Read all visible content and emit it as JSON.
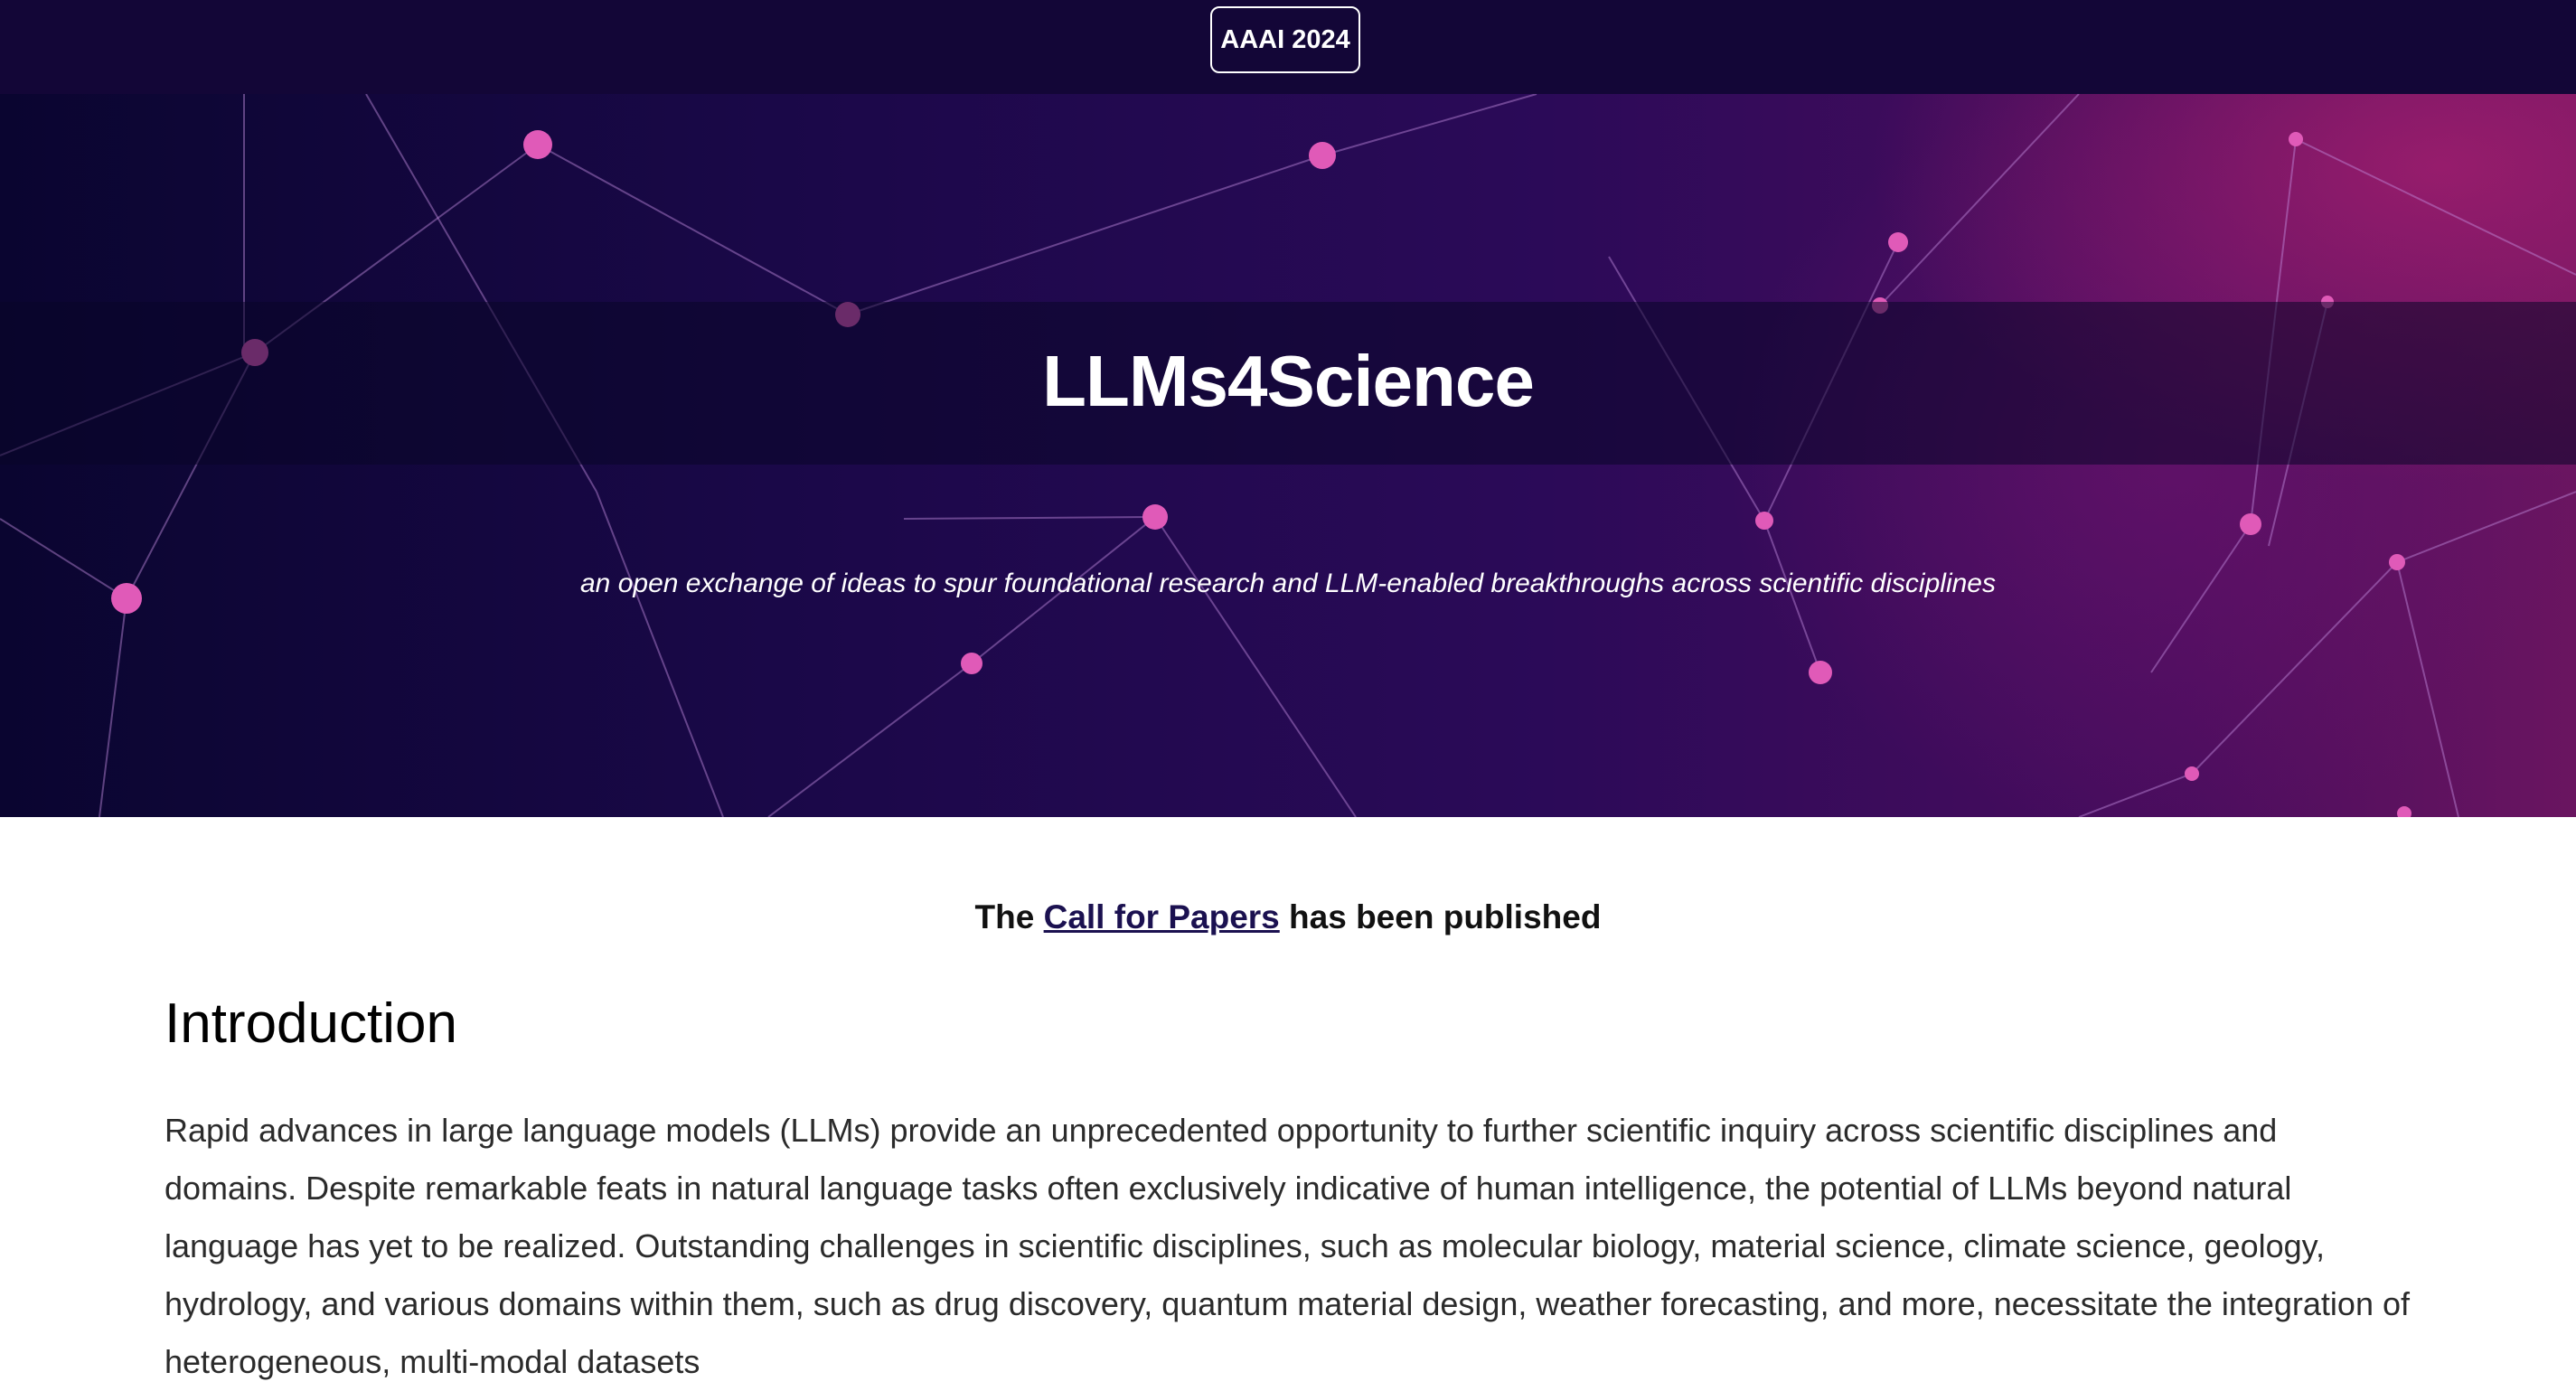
{
  "header": {
    "conference_button": "AAAI 2024"
  },
  "hero": {
    "title": "LLMs4Science",
    "subtitle": "an open exchange of ideas to spur foundational research and LLM-enabled breakthroughs across scientific disciplines"
  },
  "announcement": {
    "prefix": "The ",
    "link_text": "Call for Papers",
    "suffix": " has been published"
  },
  "introduction": {
    "heading": "Introduction",
    "body": "Rapid advances in large language models (LLMs) provide an unprecedented opportunity to further scientific inquiry across scientific disciplines and domains. Despite remarkable feats in natural language tasks often exclusively indicative of human intelligence, the potential of LLMs beyond natural language has yet to be realized. Outstanding challenges in scientific disciplines, such as molecular biology, material science, climate science, geology, hydrology, and various domains within them, such as drug discovery, quantum material design, weather forecasting, and more, necessitate the integration of heterogeneous, multi-modal datasets"
  },
  "colors": {
    "topbar_background": "#130637",
    "hero_dark": "#0a0530",
    "hero_magenta": "#6a1560",
    "link_color": "#1b1150",
    "network_node": "#e05ab8"
  },
  "icons": {
    "hero_background": "network-nodes-graphic"
  }
}
